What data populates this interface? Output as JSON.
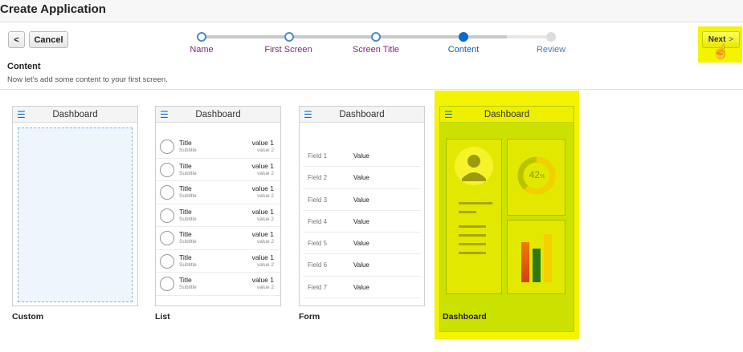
{
  "header": {
    "title": "Create Application"
  },
  "toolbar": {
    "back_label": "<",
    "cancel_label": "Cancel",
    "next_label": "Next",
    "next_arrow": ">"
  },
  "train": {
    "steps": [
      {
        "label": "Name",
        "state": "visited"
      },
      {
        "label": "First Screen",
        "state": "visited"
      },
      {
        "label": "Screen Title",
        "state": "visited"
      },
      {
        "label": "Content",
        "state": "current"
      },
      {
        "label": "Review",
        "state": "future"
      }
    ],
    "colors": {
      "visited_label": "#7a2a7e",
      "current_label": "#0a5fb4",
      "future_label": "#4a79a8"
    }
  },
  "section": {
    "title": "Content",
    "subtitle": "Now let's add some content to your first screen."
  },
  "templates": [
    {
      "name": "Custom",
      "header": "Dashboard"
    },
    {
      "name": "List",
      "header": "Dashboard",
      "items": [
        {
          "title": "Title",
          "subtitle": "Subtitle",
          "value1": "value 1",
          "value2": "value 2"
        },
        {
          "title": "Title",
          "subtitle": "Subtitle",
          "value1": "value 1",
          "value2": "value 2"
        },
        {
          "title": "Title",
          "subtitle": "Subtitle",
          "value1": "value 1",
          "value2": "value 2"
        },
        {
          "title": "Title",
          "subtitle": "Subtitle",
          "value1": "value 1",
          "value2": "value 2"
        },
        {
          "title": "Title",
          "subtitle": "Subtitle",
          "value1": "value 1",
          "value2": "value 2"
        },
        {
          "title": "Title",
          "subtitle": "Subtitle",
          "value1": "value 1",
          "value2": "value 2"
        },
        {
          "title": "Title",
          "subtitle": "Subtitle",
          "value1": "value 1",
          "value2": "value 2"
        }
      ]
    },
    {
      "name": "Form",
      "header": "Dashboard",
      "fields": [
        {
          "label": "Field 1",
          "value": "Value"
        },
        {
          "label": "Field 2",
          "value": "Value"
        },
        {
          "label": "Field 3",
          "value": "Value"
        },
        {
          "label": "Field 4",
          "value": "Value"
        },
        {
          "label": "Field 5",
          "value": "Value"
        },
        {
          "label": "Field 6",
          "value": "Value"
        },
        {
          "label": "Field 7",
          "value": "Value"
        }
      ]
    },
    {
      "name": "Dashboard",
      "header": "Dashboard",
      "selected": true,
      "gauge_value": "42",
      "gauge_unit": "%"
    }
  ],
  "icons": {
    "menu": "hamburger-icon",
    "cursor": "hand-pointer-icon",
    "avatar": "user-avatar-icon"
  },
  "colors": {
    "highlight": "#f4f400",
    "accent": "#0572ce",
    "bar_orange": "#f07c00",
    "bar_red": "#d3401a",
    "bar_green": "#2c7a1a",
    "bar_yellow": "#f5d000"
  }
}
